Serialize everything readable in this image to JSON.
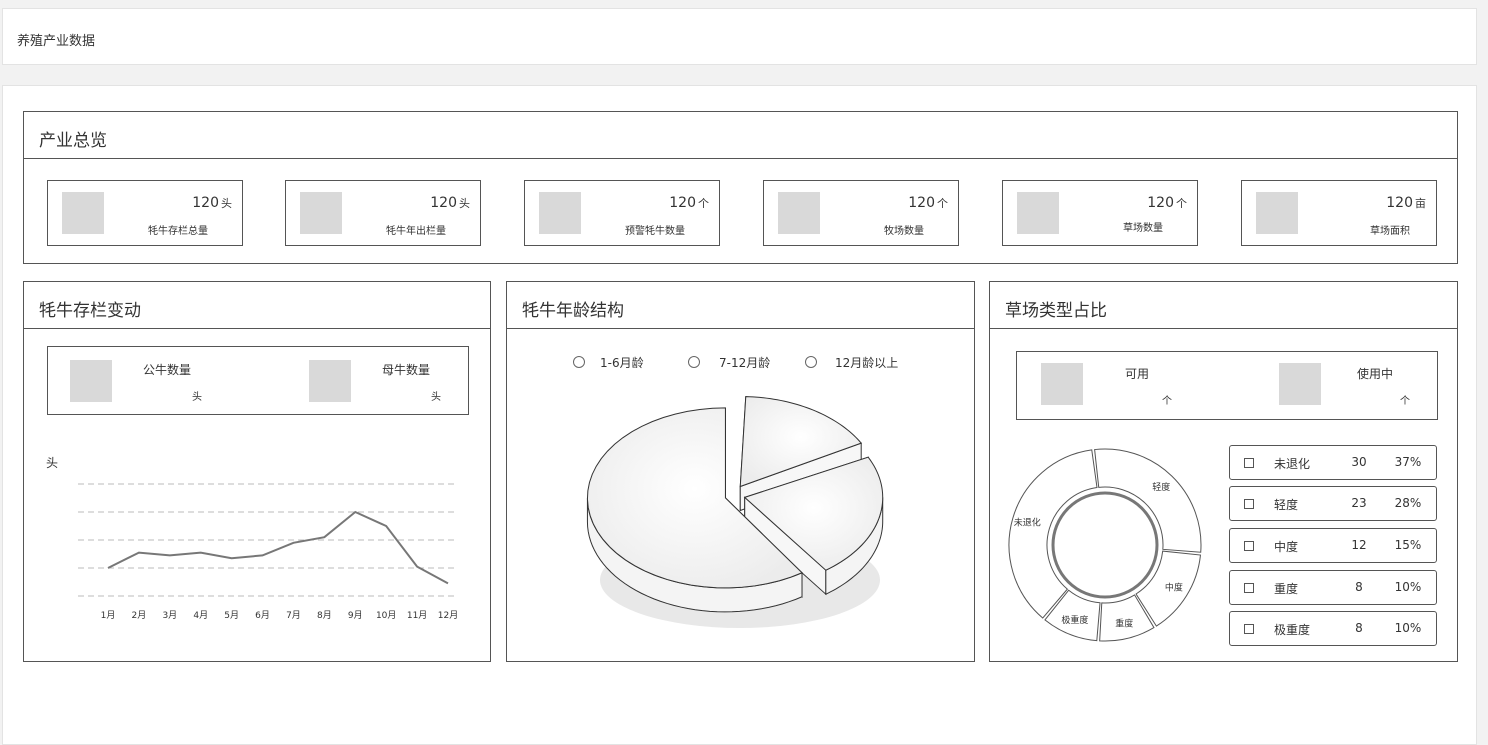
{
  "header": {
    "title": "养殖产业数据"
  },
  "overview": {
    "title": "产业总览",
    "stats": [
      {
        "value": "120",
        "unit": "头",
        "label": "牦牛存栏总量"
      },
      {
        "value": "120",
        "unit": "头",
        "label": "牦牛年出栏量"
      },
      {
        "value": "120",
        "unit": "个",
        "label": "预警牦牛数量"
      },
      {
        "value": "120",
        "unit": "个",
        "label": "牧场数量"
      },
      {
        "value": "120",
        "unit": "个",
        "label": "草场数量"
      },
      {
        "value": "120",
        "unit": "亩",
        "label": "草场面积"
      }
    ]
  },
  "stock": {
    "title": "牦牛存栏变动",
    "bull_label": "公牛数量",
    "bull_unit": "头",
    "cow_label": "母牛数量",
    "cow_unit": "头",
    "chart_unit": "头"
  },
  "age": {
    "title": "牦牛年龄结构",
    "legend": [
      "1-6月龄",
      "7-12月龄",
      "12月龄以上"
    ]
  },
  "grass": {
    "title": "草场类型占比",
    "available_label": "可用",
    "available_unit": "个",
    "inuse_label": "使用中",
    "inuse_unit": "个",
    "rows": [
      {
        "name": "未退化",
        "count": "30",
        "percent": "37%"
      },
      {
        "name": "轻度",
        "count": "23",
        "percent": "28%"
      },
      {
        "name": "中度",
        "count": "12",
        "percent": "15%"
      },
      {
        "name": "重度",
        "count": "8",
        "percent": "10%"
      },
      {
        "name": "极重度",
        "count": "8",
        "percent": "10%"
      }
    ]
  },
  "chart_data": [
    {
      "type": "line",
      "categories": [
        "1月",
        "2月",
        "3月",
        "4月",
        "5月",
        "6月",
        "7月",
        "8月",
        "9月",
        "10月",
        "11月",
        "12月"
      ],
      "series": [
        {
          "values": [
            1.0,
            1.55,
            1.45,
            1.55,
            1.35,
            1.45,
            1.9,
            2.1,
            3.0,
            2.5,
            1.05,
            0.45
          ]
        }
      ],
      "ylabel": "头",
      "ylim": [
        0,
        4
      ],
      "grid": true
    },
    {
      "type": "pie",
      "categories": [
        "1-6月龄",
        "7-12月龄",
        "12月龄以上"
      ],
      "values": [
        0.17,
        0.23,
        0.6
      ]
    },
    {
      "type": "pie",
      "categories": [
        "未退化",
        "轻度",
        "中度",
        "重度",
        "极重度"
      ],
      "values": [
        30,
        23,
        12,
        8,
        8
      ],
      "donut": true
    }
  ]
}
